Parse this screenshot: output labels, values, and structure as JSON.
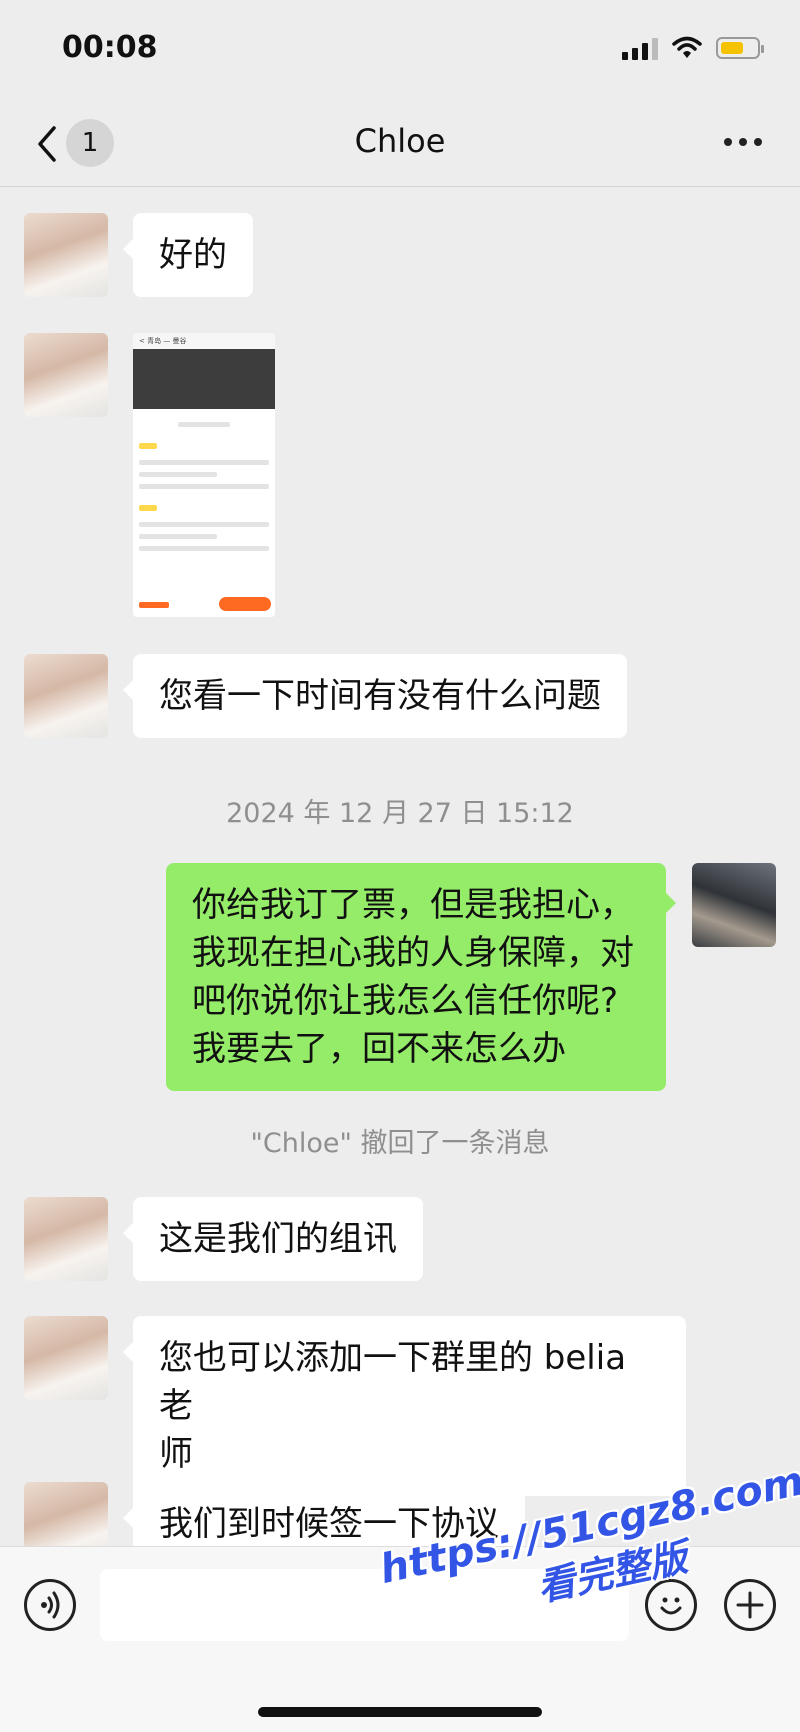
{
  "status_bar": {
    "time": "00:08",
    "battery_color": "#f5c200"
  },
  "nav": {
    "back_icon": "chevron-left-icon",
    "unread_count": "1",
    "title": "Chloe",
    "more_icon": "more-dots-icon"
  },
  "messages": [
    {
      "sender": "Chloe",
      "type": "text",
      "text": "好的"
    },
    {
      "sender": "Chloe",
      "type": "image",
      "image_description": "航班详情 screenshot"
    },
    {
      "sender": "Chloe",
      "type": "text",
      "text": "您看一下时间有没有什么问题"
    },
    {
      "type": "timestamp",
      "text": "2024 年 12 月 27 日 15:12"
    },
    {
      "sender": "me",
      "type": "text",
      "lines": [
        "你给我订了票，但是我担心，",
        "我现在担心我的人身保障，对",
        "吧你说你让我怎么信任你呢?",
        "我要去了，回不来怎么办"
      ]
    },
    {
      "type": "system",
      "text": "\"Chloe\" 撤回了一条消息"
    },
    {
      "sender": "Chloe",
      "type": "text",
      "text": "这是我们的组讯"
    },
    {
      "sender": "Chloe",
      "type": "text",
      "lines": [
        "您也可以添加一下群里的 belia 老",
        "师"
      ]
    },
    {
      "sender": "Chloe",
      "type": "text",
      "text": "我们到时候签一下协议"
    }
  ],
  "image_thumb": {
    "top_label": "< 青岛 — 曼谷"
  },
  "input_bar": {
    "voice_icon": "voice-icon",
    "emoji_icon": "emoji-icon",
    "plus_icon": "plus-icon",
    "placeholder": ""
  },
  "watermark": {
    "url": "https://51cgz8.com",
    "sub": "看完整版"
  },
  "colors": {
    "my_bubble": "#95ec69",
    "their_bubble": "#ffffff",
    "background": "#ededed"
  }
}
